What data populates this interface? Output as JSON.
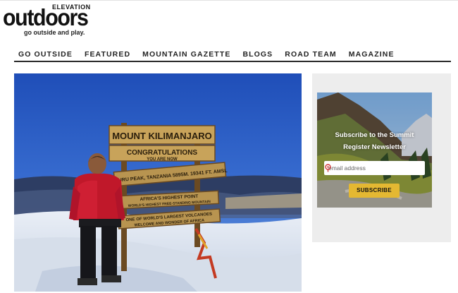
{
  "logo": {
    "elevation": "ELEVATION",
    "brand": "outdoors",
    "tagline": "go outside and play."
  },
  "nav": {
    "items": [
      {
        "label": "GO OUTSIDE"
      },
      {
        "label": "FEATURED"
      },
      {
        "label": "MOUNTAIN GAZETTE"
      },
      {
        "label": "BLOGS"
      },
      {
        "label": "ROAD TEAM"
      },
      {
        "label": "MAGAZINE"
      }
    ]
  },
  "hero": {
    "signs": {
      "line1": "MOUNT KILIMANJARO",
      "line2": "CONGRATULATIONS",
      "line3": "YOU ARE NOW",
      "line4": "UHURU PEAK, TANZANIA 5895M. 19341 FT. AMSL",
      "line5": "AFRICA'S HIGHEST POINT",
      "line6": "WORLD'S HIGHEST FREE-STANDING MOUNTAIN",
      "line7": "ONE OF WORLD'S LARGEST VOLCANOES",
      "line8": "WELCOME AND WONDER OF AFRICA"
    }
  },
  "newsletter": {
    "title_line1": "Subscribe to the Summit",
    "title_line2": "Register Newsletter",
    "email_placeholder": "email address",
    "subscribe_label": "SUBSCRIBE"
  },
  "colors": {
    "nav_text": "#222222",
    "subscribe_button": "#e4b832",
    "sidebar_bg": "#ededed",
    "sky": "#2a5bbf"
  },
  "icons": {
    "email_field_icon": "pin-icon"
  }
}
